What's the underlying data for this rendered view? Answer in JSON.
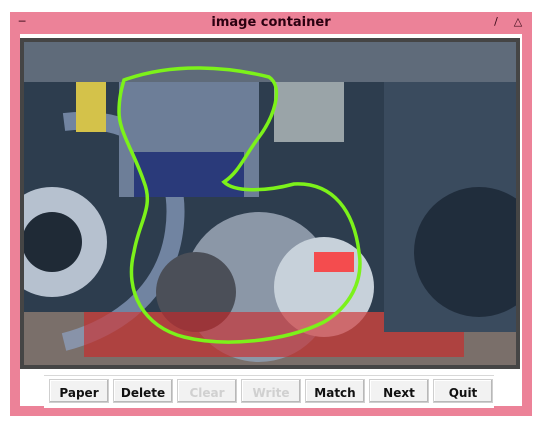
{
  "window": {
    "title": "image container"
  },
  "buttons": {
    "paper": "Paper",
    "delete": "Delete",
    "clear": "Clear",
    "write": "Write",
    "match": "Match",
    "next": "Next",
    "quit": "Quit"
  },
  "colors": {
    "titlebar": "#ec8298",
    "outline": "#7cf21a",
    "image_border": "#454545"
  },
  "icons": {
    "window_menu": "dash-icon",
    "minimize": "slash-icon",
    "maximize": "triangle-icon"
  }
}
